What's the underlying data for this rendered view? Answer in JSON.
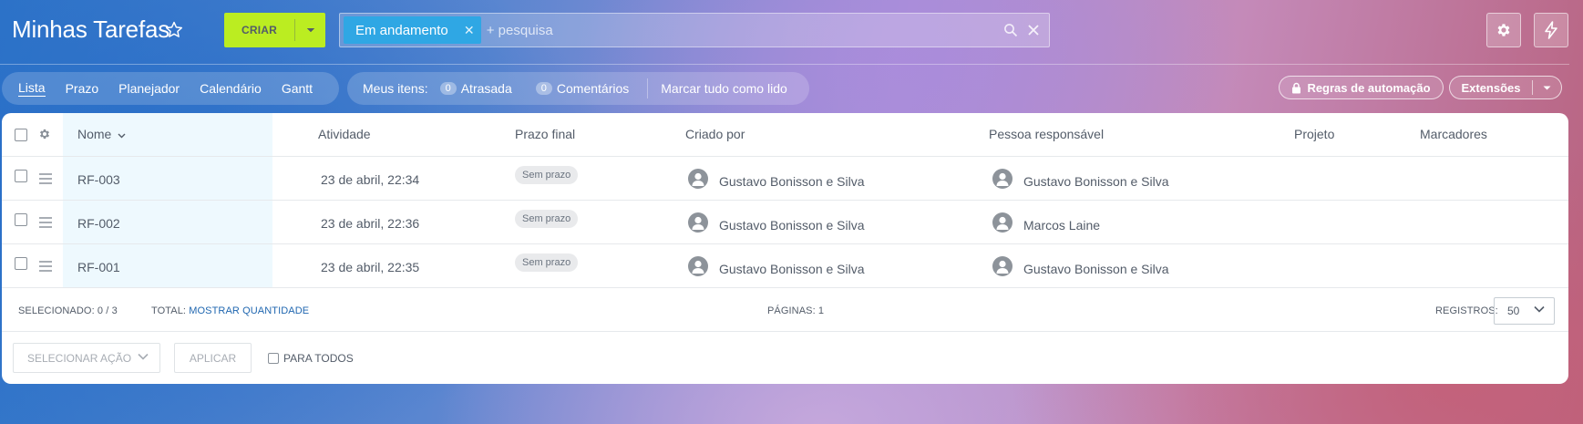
{
  "header": {
    "title": "Minhas Tarefas",
    "create_label": "CRIAR",
    "filter_chip": "Em andamento",
    "search_placeholder": "+ pesquisa"
  },
  "views": [
    "Lista",
    "Prazo",
    "Planejador",
    "Calendário",
    "Gantt"
  ],
  "counters": {
    "label": "Meus itens:",
    "items": [
      {
        "count": "0",
        "label": "Atrasada"
      },
      {
        "count": "0",
        "label": "Comentários"
      }
    ],
    "mark_all_read": "Marcar tudo como lido"
  },
  "automation_rules": "Regras de automação",
  "extensions": "Extensões",
  "grid": {
    "columns": {
      "name": "Nome",
      "activity": "Atividade",
      "deadline": "Prazo final",
      "created_by": "Criado por",
      "responsible": "Pessoa responsável",
      "project": "Projeto",
      "tags": "Marcadores"
    },
    "rows": [
      {
        "name": "RF-003",
        "activity": "23 de abril, 22:34",
        "deadline": "Sem prazo",
        "created_by": "Gustavo Bonisson e Silva",
        "responsible": "Gustavo Bonisson e Silva"
      },
      {
        "name": "RF-002",
        "activity": "23 de abril, 22:36",
        "deadline": "Sem prazo",
        "created_by": "Gustavo Bonisson e Silva",
        "responsible": "Marcos Laine"
      },
      {
        "name": "RF-001",
        "activity": "23 de abril, 22:35",
        "deadline": "Sem prazo",
        "created_by": "Gustavo Bonisson e Silva",
        "responsible": "Gustavo Bonisson e Silva"
      }
    ]
  },
  "footer": {
    "selected_label": "SELECIONADO: 0 / 3",
    "total_label": "TOTAL:",
    "total_link": "MOSTRAR QUANTIDADE",
    "pages_label": "PÁGINAS: 1",
    "records_label": "REGISTROS:",
    "records_value": "50"
  },
  "actions": {
    "select_action": "SELECIONAR AÇÃO",
    "apply": "APLICAR",
    "for_all": "PARA TODOS"
  },
  "colors": {
    "create_button": "#bbed21",
    "filter_chip": "#2fa7e4",
    "link": "#2067b0"
  }
}
